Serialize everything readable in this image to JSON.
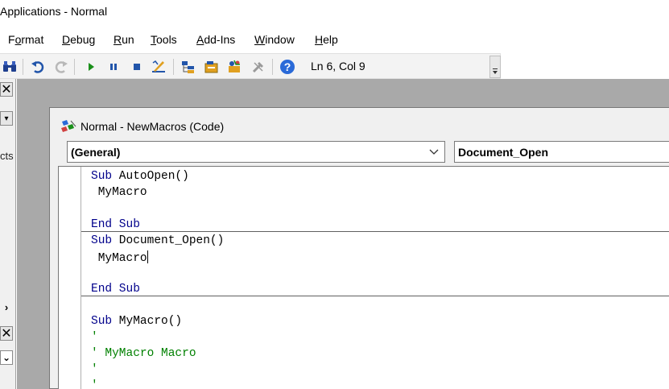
{
  "window": {
    "title": "Applications - Normal"
  },
  "menu": {
    "items": [
      {
        "label": "Format",
        "mnemonic": "o"
      },
      {
        "label": "Debug",
        "mnemonic": "D"
      },
      {
        "label": "Run",
        "mnemonic": "R"
      },
      {
        "label": "Tools",
        "mnemonic": "T"
      },
      {
        "label": "Add-Ins",
        "mnemonic": "A"
      },
      {
        "label": "Window",
        "mnemonic": "W"
      },
      {
        "label": "Help",
        "mnemonic": "H"
      }
    ]
  },
  "toolbar": {
    "position": "Ln 6, Col 9",
    "icons": [
      "binoculars-icon",
      "undo-icon",
      "redo-icon",
      "run-icon",
      "break-icon",
      "reset-icon",
      "design-mode-icon",
      "project-explorer-icon",
      "properties-window-icon",
      "object-browser-icon",
      "toolbox-icon",
      "help-icon"
    ]
  },
  "left_panel": {
    "partial_text": "cts"
  },
  "code_window": {
    "title": "Normal - NewMacros (Code)",
    "object_combo": "(General)",
    "procedure_combo": "Document_Open",
    "lines": [
      {
        "kind": "kw-sig",
        "kw": "Sub",
        "rest": " AutoOpen()"
      },
      {
        "kind": "plain",
        "text": " MyMacro"
      },
      {
        "kind": "blank",
        "text": ""
      },
      {
        "kind": "kw",
        "text": "End Sub"
      },
      {
        "kind": "kw-sig",
        "kw": "Sub",
        "rest": " Document_Open()"
      },
      {
        "kind": "plain-caret",
        "text": " MyMacro"
      },
      {
        "kind": "blank",
        "text": ""
      },
      {
        "kind": "kw",
        "text": "End Sub"
      },
      {
        "kind": "blank",
        "text": ""
      },
      {
        "kind": "kw-sig",
        "kw": "Sub",
        "rest": " MyMacro()"
      },
      {
        "kind": "comment",
        "text": "'"
      },
      {
        "kind": "comment",
        "text": "' MyMacro Macro"
      },
      {
        "kind": "comment",
        "text": "'"
      },
      {
        "kind": "comment",
        "text": "'"
      }
    ]
  },
  "colors": {
    "keyword": "#00008b",
    "comment": "#008000",
    "mdi_background": "#a9a9a9"
  }
}
